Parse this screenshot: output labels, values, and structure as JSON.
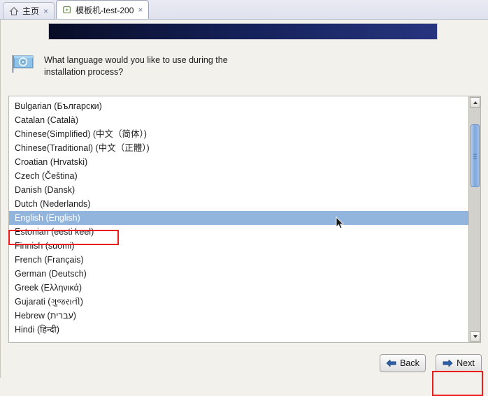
{
  "window": {
    "tabs": [
      {
        "label": "主页",
        "icon": "home-icon",
        "close": "×",
        "active": false
      },
      {
        "label": "模板机-test-200",
        "icon": "vm-console-icon",
        "close": "×",
        "active": true
      }
    ]
  },
  "installer": {
    "banner_colors": {
      "start": "#080d26",
      "mid": "#152159",
      "end": "#26357f"
    },
    "prompt_icon": "un-flag-icon",
    "prompt": "What language would you like to use during the installation process?",
    "languages": [
      "Bulgarian (Български)",
      "Catalan (Català)",
      "Chinese(Simplified) (中文（简体）)",
      "Chinese(Traditional) (中文（正體）)",
      "Croatian (Hrvatski)",
      "Czech (Čeština)",
      "Danish (Dansk)",
      "Dutch (Nederlands)",
      "English (English)",
      "Estonian (eesti keel)",
      "Finnish (suomi)",
      "French (Français)",
      "German (Deutsch)",
      "Greek (Ελληνικά)",
      "Gujarati (ગુજરાતી)",
      "Hebrew (עברית)",
      "Hindi (हिन्दी)"
    ],
    "selected_language": "English (English)",
    "selection_color": "#92b5dd",
    "annotation_color": "#ee1b1b",
    "buttons": {
      "back": "Back",
      "next": "Next"
    },
    "scrollbar": {
      "up_arrow": "scroll-up-icon",
      "down_arrow": "scroll-down-icon"
    }
  }
}
